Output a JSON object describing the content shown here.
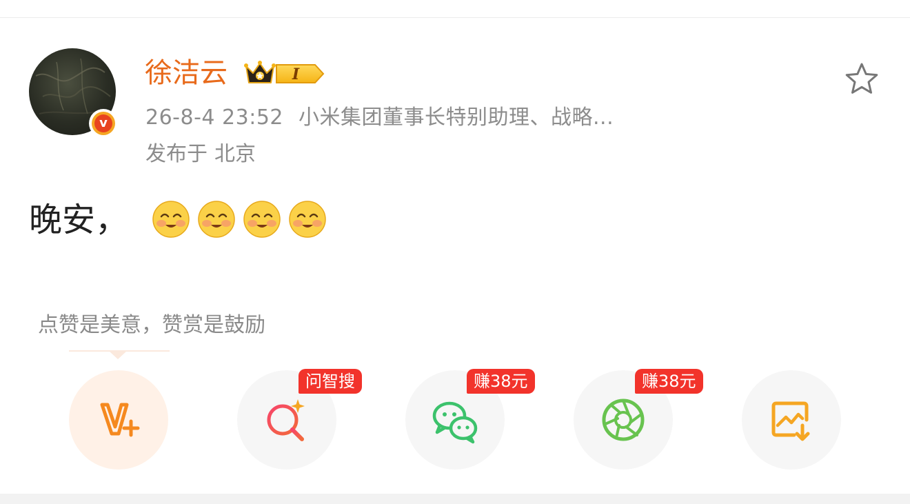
{
  "post": {
    "author": {
      "name": "徐洁云",
      "avatar_icon": "user-avatar",
      "verified_icon": "verified-v-icon",
      "verified_letter": "v",
      "member_badge_icon": "crown-member-icon",
      "member_level": "I"
    },
    "timestamp": "26-8-4 23:52",
    "author_title": "小米集团董事长特别助理、战略...",
    "location_prefix": "发布于",
    "location": "北京",
    "text": "晚安，",
    "emojis": [
      "smile-emoji",
      "smile-emoji",
      "smile-emoji",
      "smile-emoji"
    ],
    "favorite_icon": "star-outline-icon"
  },
  "tip": {
    "text": "点赞是美意，赞赏是鼓励"
  },
  "actions": [
    {
      "name": "reward",
      "icon": "v-plus-reward-icon",
      "badge": ""
    },
    {
      "name": "ask-search",
      "icon": "ai-search-icon",
      "badge": "问智搜"
    },
    {
      "name": "share-wechat",
      "icon": "wechat-icon",
      "badge": "赚38元"
    },
    {
      "name": "share-moments",
      "icon": "moments-aperture-icon",
      "badge": "赚38元"
    },
    {
      "name": "save-image",
      "icon": "save-image-icon",
      "badge": ""
    }
  ],
  "colors": {
    "username": "#e86a1b",
    "meta": "#8c8c8c",
    "badge_red": "#f2332b",
    "reward_orange": "#f5891f",
    "wechat_green": "#3cc26c",
    "moments_green": "#68c34f",
    "search_pink": "#ef3f6c",
    "save_orange": "#f5a623"
  }
}
